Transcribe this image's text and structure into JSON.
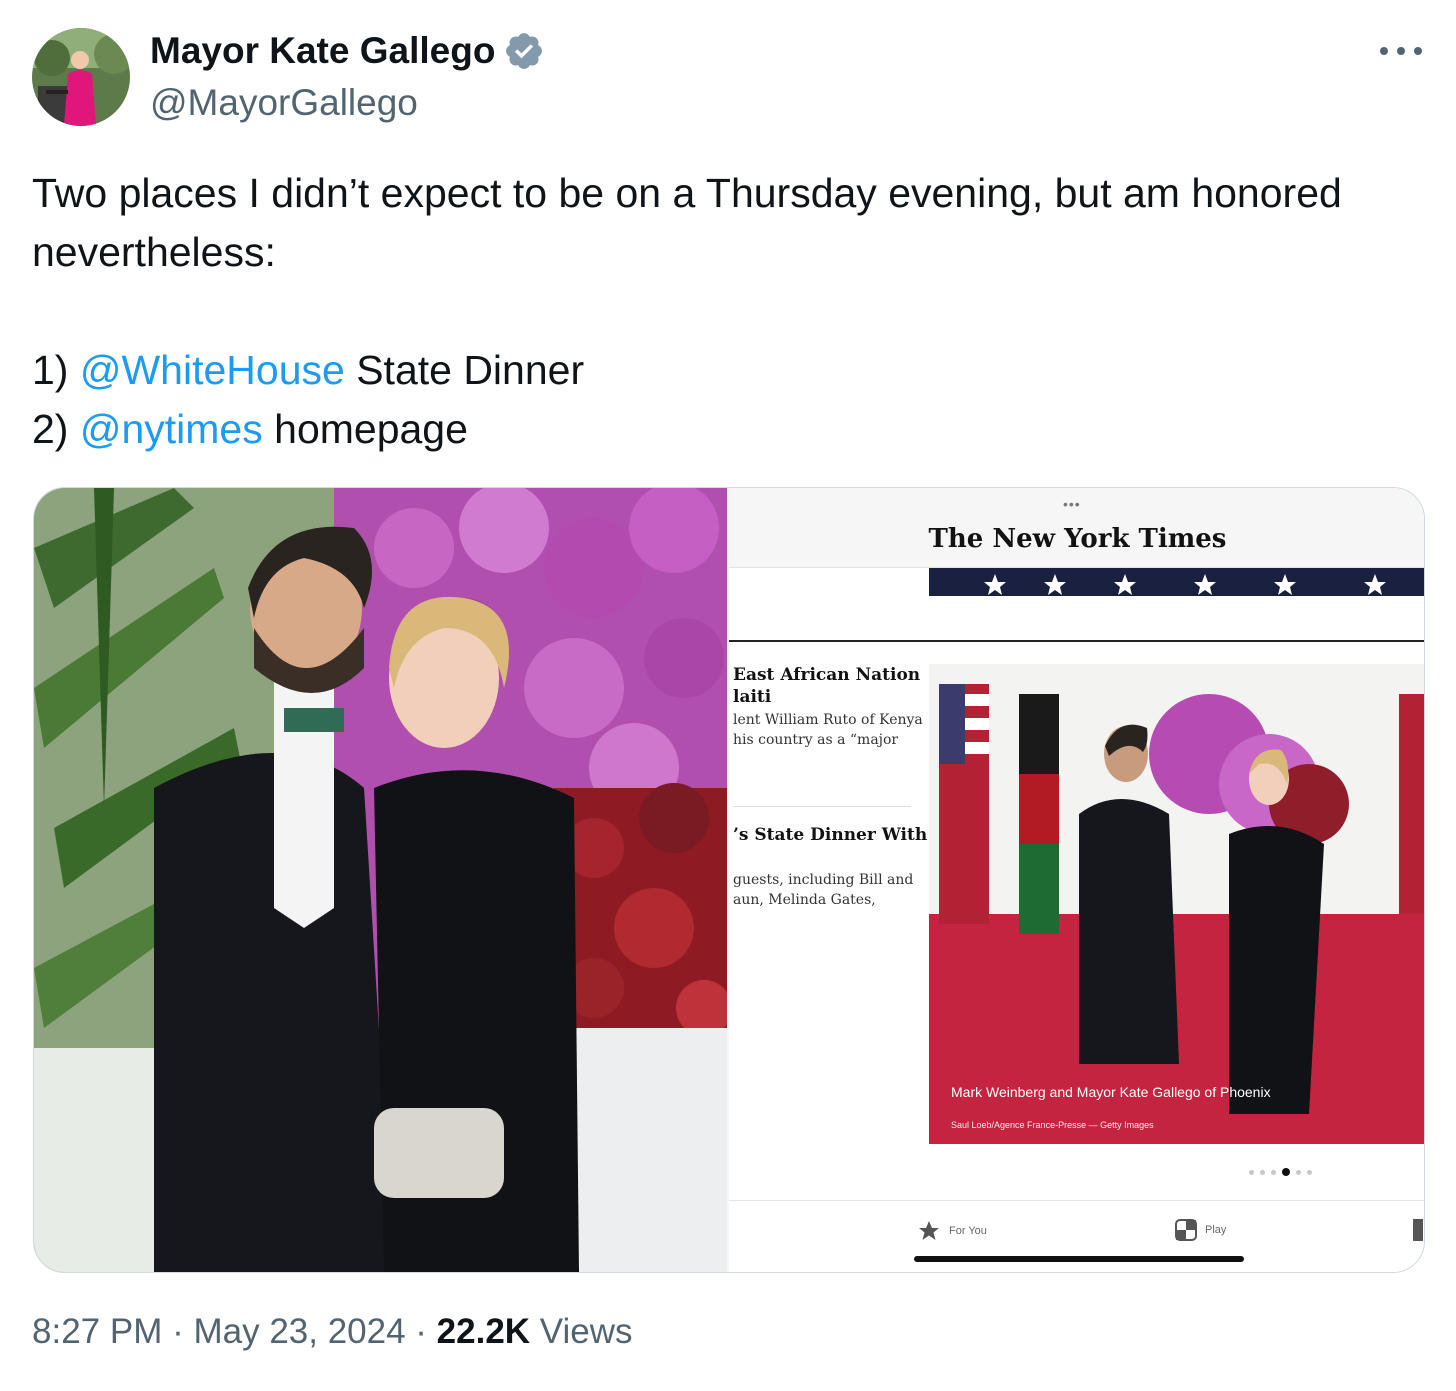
{
  "author": {
    "name": "Mayor Kate Gallego",
    "handle": "@MayorGallego",
    "verified_icon": "verified-badge-icon",
    "avatar_icon": "profile-avatar"
  },
  "more_icon": "more-options-icon",
  "tweet": {
    "line1": "Two places I didn’t expect to be on a Thursday evening, but am honored nevertheless:",
    "item1_prefix": "1) ",
    "item1_mention": "@WhiteHouse",
    "item1_suffix": " State Dinner",
    "item2_prefix": "2) ",
    "item2_mention": "@nytimes",
    "item2_suffix": " homepage"
  },
  "media": {
    "left_photo": "couple-at-state-dinner-photo",
    "right_screenshot": {
      "dots": "•••",
      "logo": "The New York Times",
      "stories": [
        {
          "headline_1": "East African Nation",
          "headline_2": "laiti",
          "summary_1": "lent William Ruto of Kenya",
          "summary_2": "his country as a “major"
        },
        {
          "headline_1": "’s State Dinner With",
          "summary_1": "guests, including Bill and",
          "summary_2": "aun, Melinda Gates,"
        }
      ],
      "caption": "Mark Weinberg and Mayor Kate Gallego of Phoenix",
      "credit": "Saul Loeb/Agence France-Presse — Getty Images",
      "tabs": [
        {
          "label": "For You",
          "icon": "star-icon"
        },
        {
          "label": "Play",
          "icon": "games-icon"
        }
      ]
    }
  },
  "meta": {
    "time": "8:27 PM",
    "sep1": " · ",
    "date": "May 23, 2024",
    "sep2": " · ",
    "views_count": "22.2K",
    "views_label": " Views"
  },
  "colors": {
    "text": "#0f1419",
    "secondary": "#536471",
    "link": "#1d9bf0",
    "verified": "#829aab"
  }
}
